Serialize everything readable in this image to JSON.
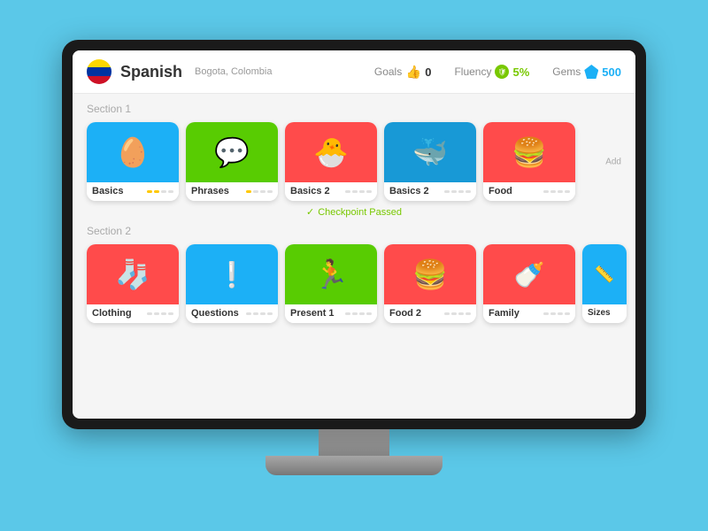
{
  "app": {
    "background_color": "#5bc8e8"
  },
  "header": {
    "language": "Spanish",
    "location": "Bogota, Colombia",
    "goals_label": "Goals",
    "goals_value": "0",
    "fluency_label": "Fluency",
    "fluency_value": "5%",
    "gems_label": "Gems",
    "gems_value": "500"
  },
  "section1": {
    "label": "Section 1",
    "cards": [
      {
        "title": "Basics",
        "color": "blue",
        "emoji": "🥚",
        "dots": [
          true,
          true,
          false,
          false
        ]
      },
      {
        "title": "Phrases",
        "color": "green",
        "emoji": "💬",
        "dots": [
          true,
          false,
          false,
          false
        ]
      },
      {
        "title": "Basics 2",
        "color": "red",
        "emoji": "🐣",
        "dots": [
          false,
          false,
          false,
          false
        ]
      },
      {
        "title": "Basics 2",
        "color": "blue",
        "emoji": "🐳",
        "dots": [
          false,
          false,
          false,
          false
        ]
      },
      {
        "title": "Food",
        "color": "red",
        "emoji": "🍔",
        "dots": [
          false,
          false,
          false,
          false
        ]
      }
    ],
    "add_label": "Add",
    "checkpoint_text": "Checkpoint Passed"
  },
  "section2": {
    "label": "Section 2",
    "cards": [
      {
        "title": "Clothing",
        "color": "red",
        "emoji": "🧦",
        "dots": [
          false,
          false,
          false,
          false
        ]
      },
      {
        "title": "Questions",
        "color": "blue",
        "emoji": "❕",
        "dots": [
          false,
          false,
          false,
          false
        ]
      },
      {
        "title": "Present 1",
        "color": "green",
        "emoji": "🏃",
        "dots": [
          false,
          false,
          false,
          false
        ]
      },
      {
        "title": "Food 2",
        "color": "red",
        "emoji": "🍔",
        "dots": [
          false,
          false,
          false,
          false
        ]
      },
      {
        "title": "Family",
        "color": "red",
        "emoji": "🍼",
        "dots": [
          false,
          false,
          false,
          false
        ]
      },
      {
        "title": "Sizes",
        "color": "blue",
        "emoji": "📏",
        "dots": [
          false,
          false,
          false,
          false
        ]
      }
    ]
  }
}
